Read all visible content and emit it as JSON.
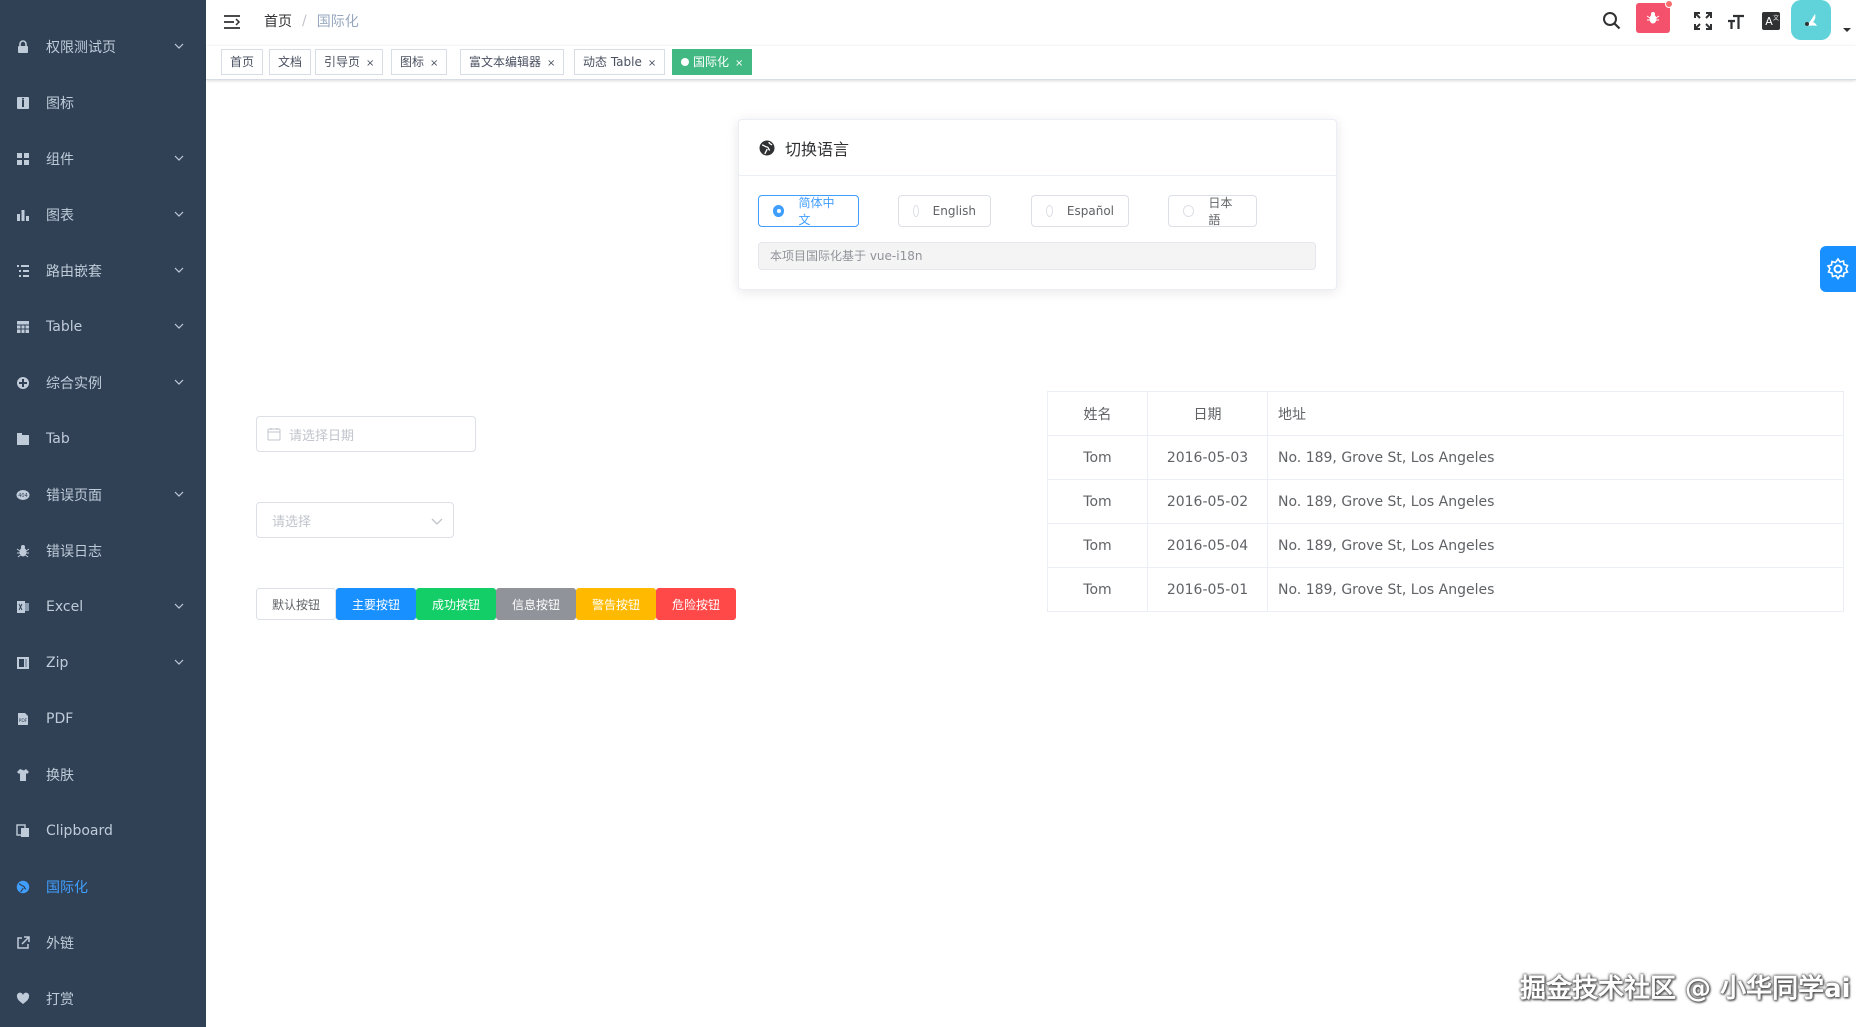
{
  "sidebar": {
    "items": [
      {
        "label": "权限测试页",
        "icon": "lock-icon",
        "has_children": true
      },
      {
        "label": "图标",
        "icon": "icon-icon",
        "has_children": false
      },
      {
        "label": "组件",
        "icon": "component-icon",
        "has_children": true
      },
      {
        "label": "图表",
        "icon": "chart-icon",
        "has_children": true
      },
      {
        "label": "路由嵌套",
        "icon": "nested-icon",
        "has_children": true
      },
      {
        "label": "Table",
        "icon": "table-icon",
        "has_children": true
      },
      {
        "label": "综合实例",
        "icon": "example-icon",
        "has_children": true
      },
      {
        "label": "Tab",
        "icon": "tab-icon",
        "has_children": false
      },
      {
        "label": "错误页面",
        "icon": "404-icon",
        "has_children": true
      },
      {
        "label": "错误日志",
        "icon": "bug-icon",
        "has_children": false
      },
      {
        "label": "Excel",
        "icon": "excel-icon",
        "has_children": true
      },
      {
        "label": "Zip",
        "icon": "zip-icon",
        "has_children": true
      },
      {
        "label": "PDF",
        "icon": "pdf-icon",
        "has_children": false
      },
      {
        "label": "换肤",
        "icon": "shirt-icon",
        "has_children": false
      },
      {
        "label": "Clipboard",
        "icon": "clipboard-icon",
        "has_children": false
      },
      {
        "label": "国际化",
        "icon": "international-icon",
        "has_children": false,
        "active": true
      },
      {
        "label": "外链",
        "icon": "link-icon",
        "has_children": false
      },
      {
        "label": "打赏",
        "icon": "money-icon",
        "has_children": false
      }
    ]
  },
  "navbar": {
    "breadcrumb": {
      "home": "首页",
      "separator": "/",
      "current": "国际化"
    }
  },
  "tags": [
    {
      "label": "首页",
      "closable": false
    },
    {
      "label": "文档",
      "closable": false
    },
    {
      "label": "引导页",
      "closable": true,
      "close": "×"
    },
    {
      "label": "图标",
      "closable": true,
      "close": "×"
    },
    {
      "label": "富文本编辑器",
      "closable": true,
      "close": "×"
    },
    {
      "label": "动态 Table",
      "closable": true,
      "close": "×"
    },
    {
      "label": "国际化",
      "closable": true,
      "active": true,
      "close": "×"
    }
  ],
  "language_card": {
    "title": "切换语言",
    "options": [
      "简体中文",
      "English",
      "Español",
      "日本語"
    ],
    "selected": "简体中文",
    "tip": "本项目国际化基于 vue-i18n"
  },
  "form": {
    "date_placeholder": "请选择日期",
    "select_placeholder": "请选择"
  },
  "buttons": [
    {
      "label": "默认按钮",
      "type": "default",
      "color": "#ffffff"
    },
    {
      "label": "主要按钮",
      "type": "primary",
      "color": "#1890ff"
    },
    {
      "label": "成功按钮",
      "type": "success",
      "color": "#13ce66"
    },
    {
      "label": "信息按钮",
      "type": "info",
      "color": "#909399"
    },
    {
      "label": "警告按钮",
      "type": "warning",
      "color": "#ffba00"
    },
    {
      "label": "危险按钮",
      "type": "danger",
      "color": "#ff4949"
    }
  ],
  "table": {
    "headers": [
      "姓名",
      "日期",
      "地址"
    ],
    "rows": [
      [
        "Tom",
        "2016-05-03",
        "No. 189, Grove St, Los Angeles"
      ],
      [
        "Tom",
        "2016-05-02",
        "No. 189, Grove St, Los Angeles"
      ],
      [
        "Tom",
        "2016-05-04",
        "No. 189, Grove St, Los Angeles"
      ],
      [
        "Tom",
        "2016-05-01",
        "No. 189, Grove St, Los Angeles"
      ]
    ]
  },
  "watermark": "掘金技术社区 @ 小华同学ai",
  "colors": {
    "sidebar_bg": "#304156",
    "sidebar_text": "#bfcbd9",
    "sidebar_active": "#409eff",
    "active_tag": "#42b983",
    "bug_badge": "#f4516c",
    "avatar": "#5fd3d9",
    "panel_toggle": "#1890ff"
  }
}
